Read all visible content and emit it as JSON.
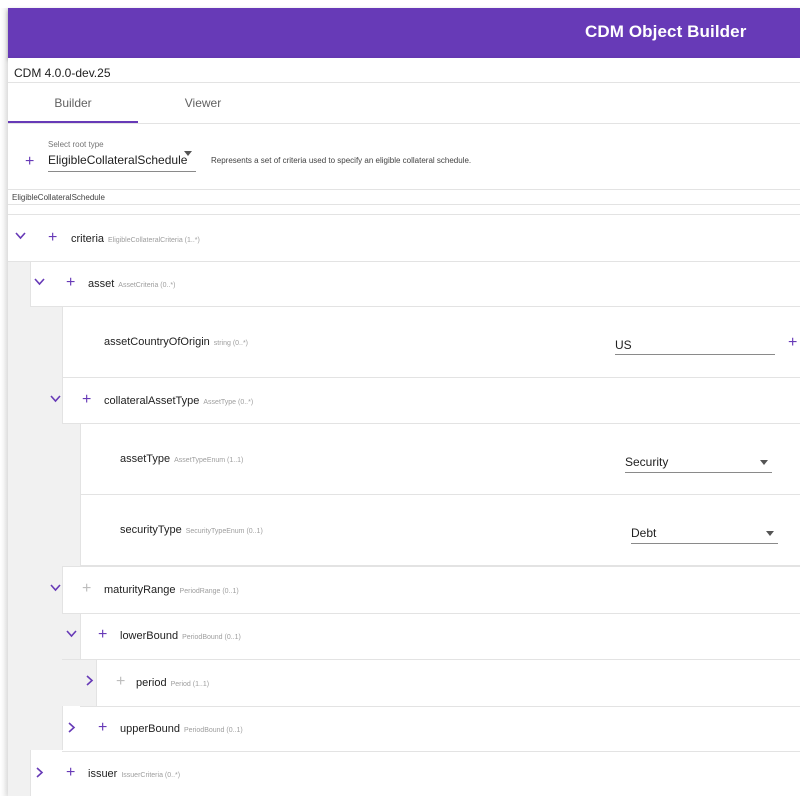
{
  "app": {
    "title": "CDM Object Builder"
  },
  "version": "CDM  4.0.0-dev.25",
  "tabs": [
    {
      "label": "Builder",
      "active": true
    },
    {
      "label": "Viewer",
      "active": false
    }
  ],
  "root": {
    "select_label": "Select root type",
    "selected": "EligibleCollateralSchedule",
    "description": "Represents a set of criteria used to specify an eligible collateral schedule."
  },
  "breadcrumb": "EligibleCollateralSchedule",
  "tree": {
    "criteria": {
      "name": "criteria",
      "type": "EligibleCollateralCriteria (1..*)"
    },
    "asset": {
      "name": "asset",
      "type": "AssetCriteria (0..*)"
    },
    "assetCountryOfOrigin": {
      "name": "assetCountryOfOrigin",
      "type": "string (0..*)",
      "value": "US"
    },
    "collateralAssetType": {
      "name": "collateralAssetType",
      "type": "AssetType (0..*)"
    },
    "assetType": {
      "name": "assetType",
      "type": "AssetTypeEnum (1..1)",
      "value": "Security"
    },
    "securityType": {
      "name": "securityType",
      "type": "SecurityTypeEnum (0..1)",
      "value": "Debt"
    },
    "maturityRange": {
      "name": "maturityRange",
      "type": "PeriodRange (0..1)"
    },
    "lowerBound": {
      "name": "lowerBound",
      "type": "PeriodBound (0..1)"
    },
    "period": {
      "name": "period",
      "type": "Period (1..1)"
    },
    "upperBound": {
      "name": "upperBound",
      "type": "PeriodBound (0..1)"
    },
    "issuer": {
      "name": "issuer",
      "type": "IssuerCriteria (0..*)"
    }
  },
  "icons": {
    "plus": "+",
    "accent": "#673ab7",
    "disabled": "#bdbdbd"
  }
}
